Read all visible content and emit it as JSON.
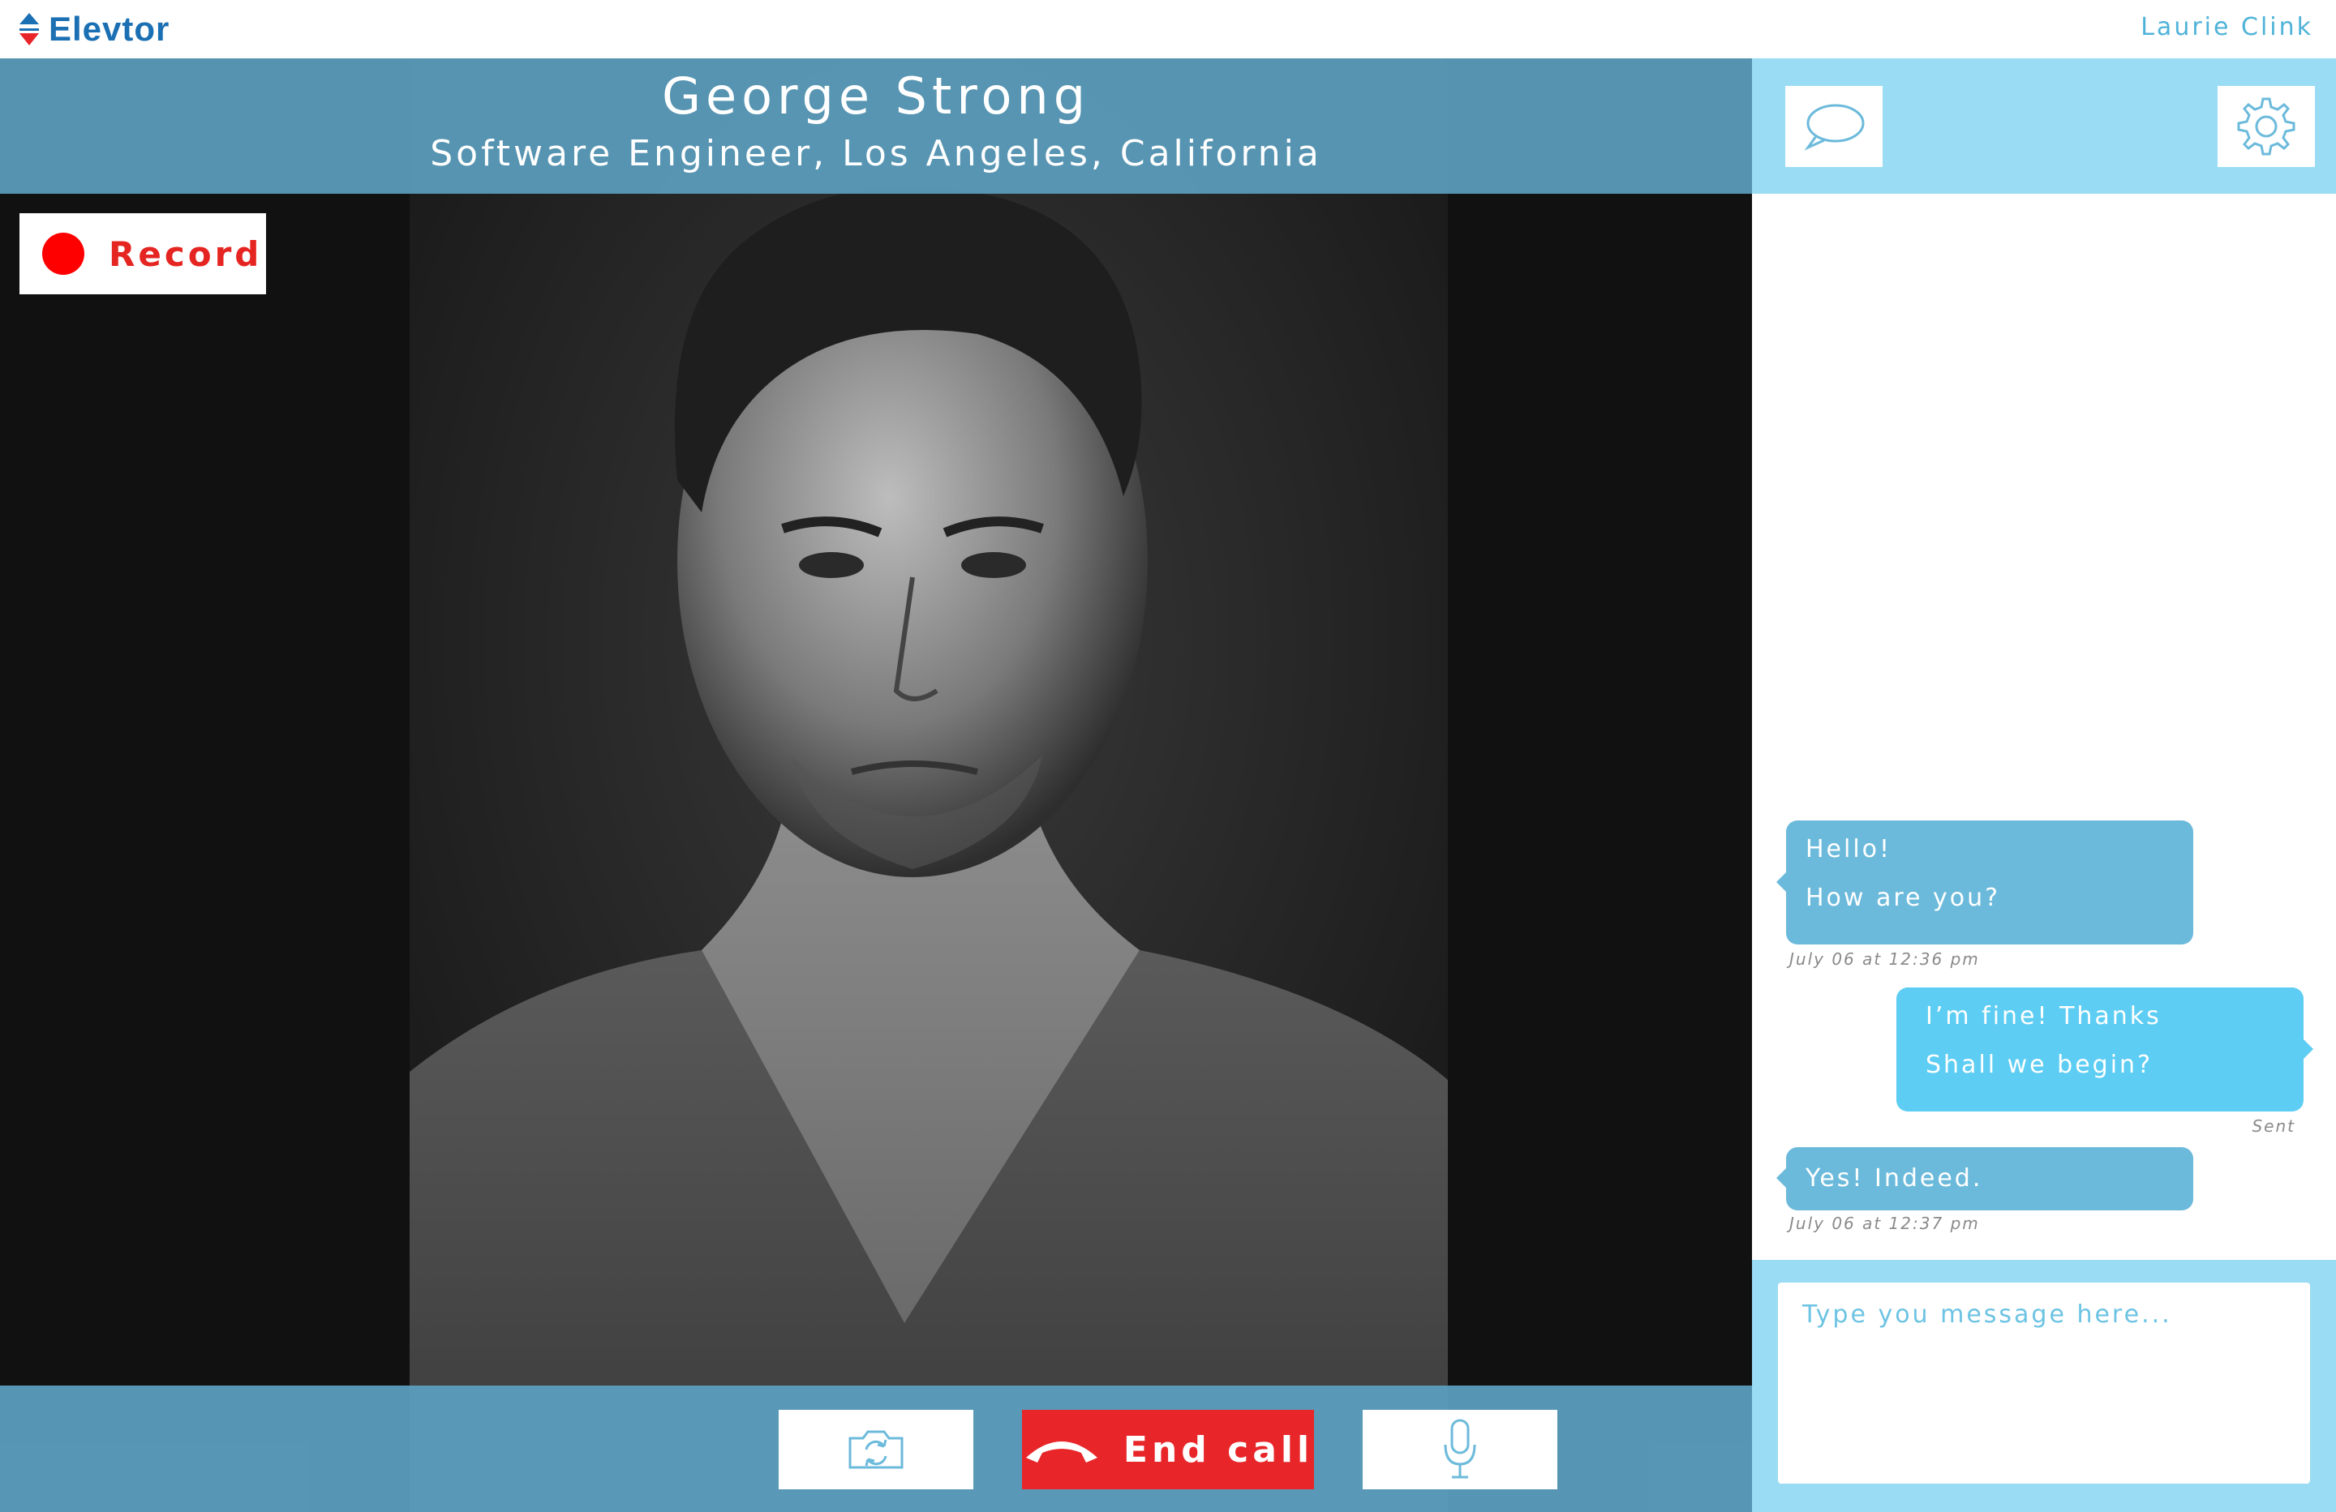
{
  "app": {
    "name": "Elevtor",
    "user_name": "Laurie Clink",
    "colors": {
      "brand": "#1b6fb3",
      "accent": "#4fb3d8",
      "header": "#5b9ebe",
      "panel": "#9adcf4",
      "record": "#ff0000",
      "end_call": "#e8262a"
    }
  },
  "call": {
    "caller_name": "George Strong",
    "caller_title": "Software Engineer, Los Angeles, California",
    "record_label": "Record",
    "controls": {
      "camera_icon": "switch-camera-icon",
      "end_call_label": "End call",
      "end_call_icon": "phone-hangup-icon",
      "mic_icon": "microphone-icon"
    }
  },
  "side_panel": {
    "chat_icon": "chat-bubble-icon",
    "settings_icon": "gear-icon",
    "messages": [
      {
        "direction": "in",
        "lines": [
          "Hello!",
          "How are you?"
        ],
        "meta": "July 06 at 12:36 pm"
      },
      {
        "direction": "out",
        "lines": [
          "I’m fine! Thanks",
          "Shall we begin?"
        ],
        "meta": "Sent"
      },
      {
        "direction": "in",
        "lines": [
          "Yes! Indeed."
        ],
        "meta": "July 06 at 12:37 pm"
      }
    ],
    "composer_placeholder": "Type you message here..."
  }
}
